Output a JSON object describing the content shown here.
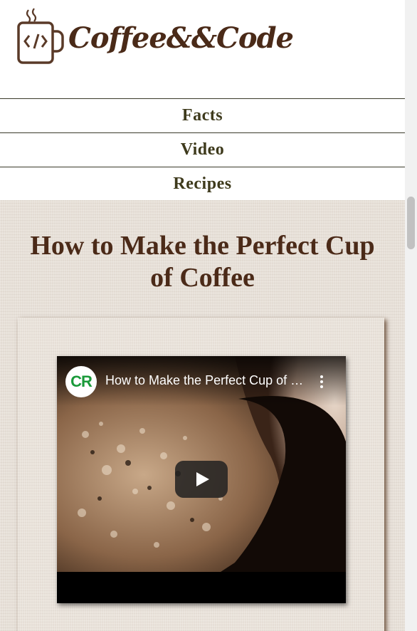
{
  "header": {
    "logo_text": "Coffee&&Code",
    "logo_icon": "coffee-mug-code-icon"
  },
  "nav": {
    "items": [
      {
        "label": "Facts"
      },
      {
        "label": "Video"
      },
      {
        "label": "Recipes"
      }
    ]
  },
  "main": {
    "title": "How to Make the Perfect Cup of Coffee"
  },
  "video": {
    "channel_initials": "CR",
    "title": "How to Make the Perfect Cup of Coffee",
    "menu_icon": "kebab-menu-icon",
    "play_icon": "play-icon"
  },
  "colors": {
    "brand_brown": "#4b2a18",
    "nav_text": "#3e3a1c",
    "channel_green": "#1a9a3a"
  }
}
